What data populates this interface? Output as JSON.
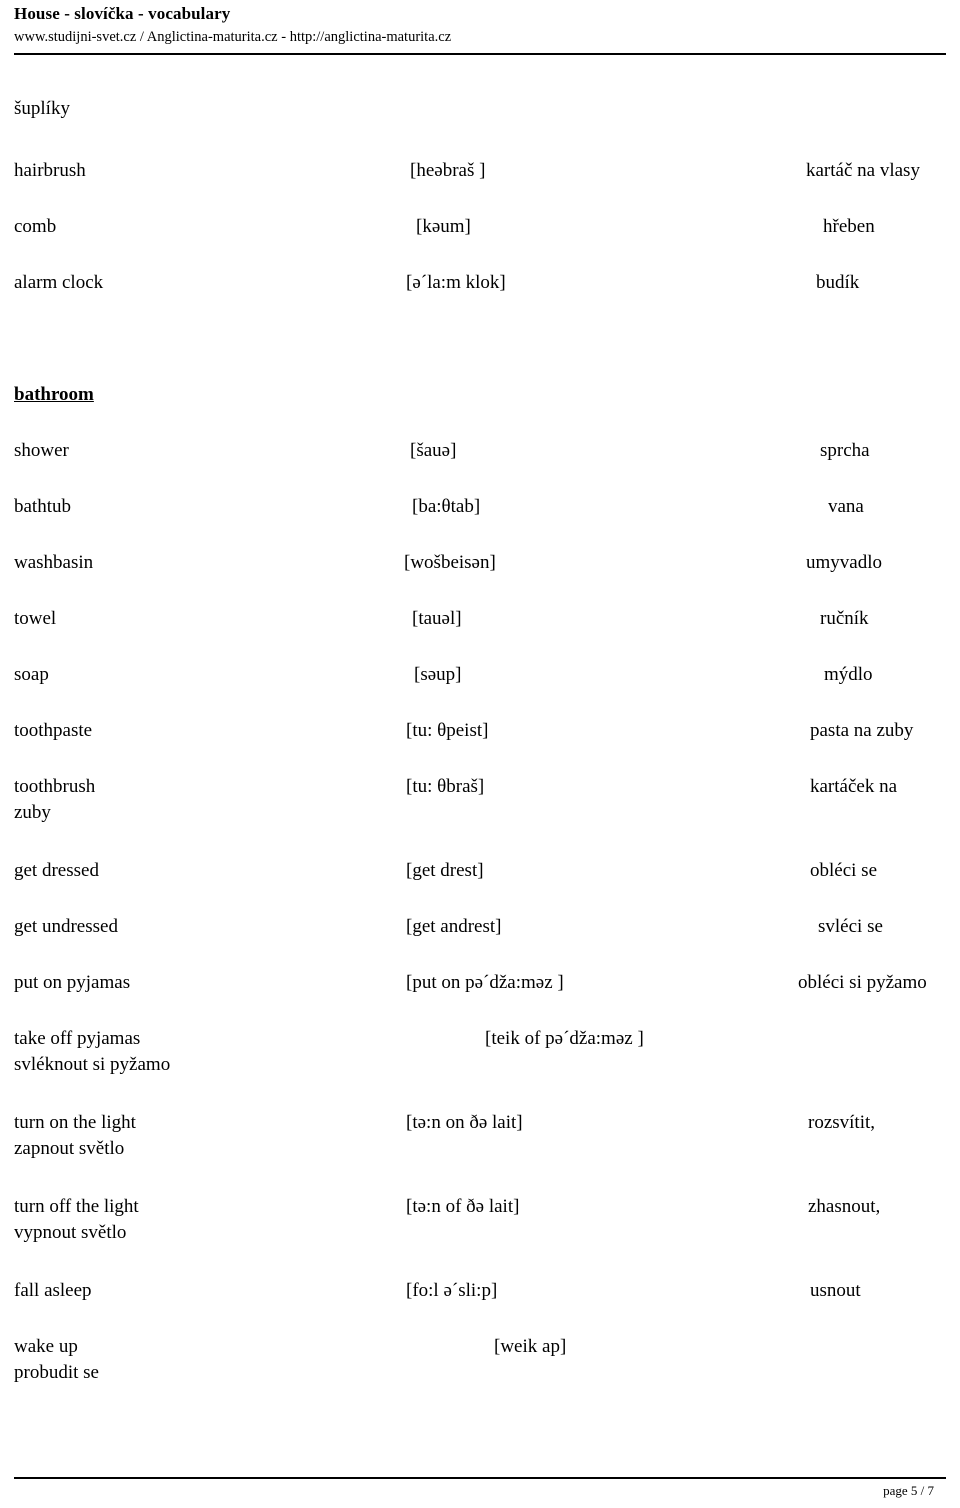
{
  "header": {
    "title": "House - slovíčka - vocabulary",
    "subtitle": "www.studijni-svet.cz / Anglictina-maturita.cz - http://anglictina-maturita.cz"
  },
  "content": {
    "orphan_word": "šuplíky",
    "sections": [
      {
        "heading": null,
        "entries": [
          {
            "english": "hairbrush",
            "pronunciation": "[heəbraš ]",
            "czech": "kartáč na vlasy",
            "czech_wrap": null
          },
          {
            "english": "comb",
            "pronunciation": "[kəum]",
            "czech": "hřeben",
            "czech_wrap": null
          },
          {
            "english": "alarm clock",
            "pronunciation": "[ə´la:m klok]",
            "czech": "budík",
            "czech_wrap": null
          }
        ]
      },
      {
        "heading": "bathroom",
        "entries": [
          {
            "english": "shower",
            "pronunciation": "[šauə]",
            "czech": "sprcha",
            "czech_wrap": null
          },
          {
            "english": "bathtub",
            "pronunciation": "[ba:θtab]",
            "czech": "vana",
            "czech_wrap": null
          },
          {
            "english": "washbasin",
            "pronunciation": "[wošbeisən]",
            "czech": "umyvadlo",
            "czech_wrap": null
          },
          {
            "english": "towel",
            "pronunciation": "[tauəl]",
            "czech": "ručník",
            "czech_wrap": null
          },
          {
            "english": "soap",
            "pronunciation": "[səup]",
            "czech": "mýdlo",
            "czech_wrap": null
          },
          {
            "english": "toothpaste",
            "pronunciation": "[tu: θpeist]",
            "czech": "pasta na zuby",
            "czech_wrap": null
          },
          {
            "english": "toothbrush",
            "pronunciation": "[tu: θbraš]",
            "czech": "kartáček na",
            "czech_wrap": "zuby"
          },
          {
            "english": "get dressed",
            "pronunciation": "[get drest]",
            "czech": "obléci se",
            "czech_wrap": null
          },
          {
            "english": "get undressed",
            "pronunciation": "[get andrest]",
            "czech": "svléci se",
            "czech_wrap": null
          },
          {
            "english": "put on pyjamas",
            "pronunciation": "[put on pə´dža:məz ]",
            "czech": "obléci si pyžamo",
            "czech_wrap": null
          },
          {
            "english": "take off pyjamas",
            "pronunciation": "[teik of  pə´dža:məz ]",
            "czech": "",
            "czech_wrap": "svléknout si pyžamo"
          },
          {
            "english": "turn on the light",
            "pronunciation": "[tə:n on ðə lait]",
            "czech": "rozsvítit,",
            "czech_wrap": "zapnout světlo"
          },
          {
            "english": "turn off the light",
            "pronunciation": "[tə:n of ðə lait]",
            "czech": "zhasnout,",
            "czech_wrap": "vypnout světlo"
          },
          {
            "english": "fall asleep",
            "pronunciation": "[fo:l  ə´sli:p]",
            "czech": "usnout",
            "czech_wrap": null
          },
          {
            "english": "wake up",
            "pronunciation": "[weik ap]",
            "czech": "",
            "czech_wrap": "probudit se"
          }
        ]
      }
    ]
  },
  "footer": {
    "page_label": "page 5 / 7"
  }
}
